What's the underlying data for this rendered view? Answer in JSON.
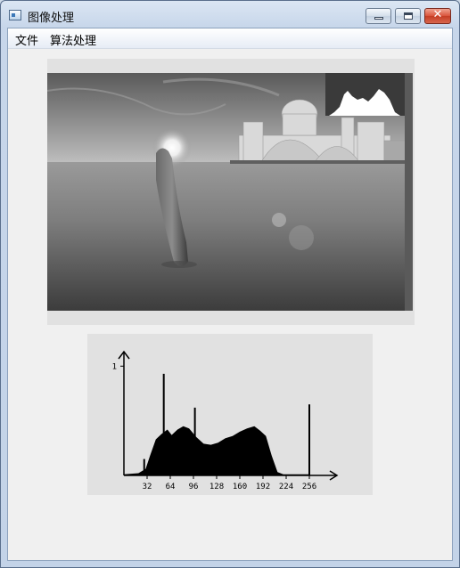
{
  "window": {
    "title": "图像处理",
    "minimize_glyph": "",
    "maximize_glyph": "",
    "close_glyph": "✕"
  },
  "menu": {
    "file": "文件",
    "algorithms": "算法处理"
  },
  "colors": {
    "titlebar": "#c7d6ea",
    "client_bg": "#f0f0f0",
    "panel_bg": "#e1e1e1",
    "close_button": "#d9533b",
    "histogram_fill": "#000000"
  },
  "image": {
    "description_icon": "image-icon",
    "inset_histogram": true
  },
  "chart_data": {
    "type": "bar",
    "x_ticks": [
      "32",
      "64",
      "96",
      "128",
      "160",
      "192",
      "224",
      "256"
    ],
    "y_ticks": [
      "1"
    ],
    "xlim": [
      0,
      256
    ],
    "ylim": [
      0,
      1.1
    ],
    "grid": false,
    "spikes": [
      {
        "x": 28,
        "y": 0.15
      },
      {
        "x": 55,
        "y": 0.93
      },
      {
        "x": 98,
        "y": 0.62
      },
      {
        "x": 256,
        "y": 0.65
      }
    ],
    "envelope": [
      {
        "x": 0,
        "y": 0.01
      },
      {
        "x": 20,
        "y": 0.02
      },
      {
        "x": 30,
        "y": 0.06
      },
      {
        "x": 36,
        "y": 0.18
      },
      {
        "x": 44,
        "y": 0.33
      },
      {
        "x": 52,
        "y": 0.38
      },
      {
        "x": 60,
        "y": 0.42
      },
      {
        "x": 66,
        "y": 0.37
      },
      {
        "x": 74,
        "y": 0.42
      },
      {
        "x": 82,
        "y": 0.45
      },
      {
        "x": 90,
        "y": 0.43
      },
      {
        "x": 100,
        "y": 0.35
      },
      {
        "x": 110,
        "y": 0.29
      },
      {
        "x": 120,
        "y": 0.28
      },
      {
        "x": 130,
        "y": 0.3
      },
      {
        "x": 140,
        "y": 0.34
      },
      {
        "x": 150,
        "y": 0.36
      },
      {
        "x": 160,
        "y": 0.4
      },
      {
        "x": 170,
        "y": 0.43
      },
      {
        "x": 180,
        "y": 0.45
      },
      {
        "x": 188,
        "y": 0.41
      },
      {
        "x": 196,
        "y": 0.36
      },
      {
        "x": 204,
        "y": 0.18
      },
      {
        "x": 212,
        "y": 0.03
      },
      {
        "x": 220,
        "y": 0.01
      },
      {
        "x": 256,
        "y": 0.01
      }
    ]
  }
}
